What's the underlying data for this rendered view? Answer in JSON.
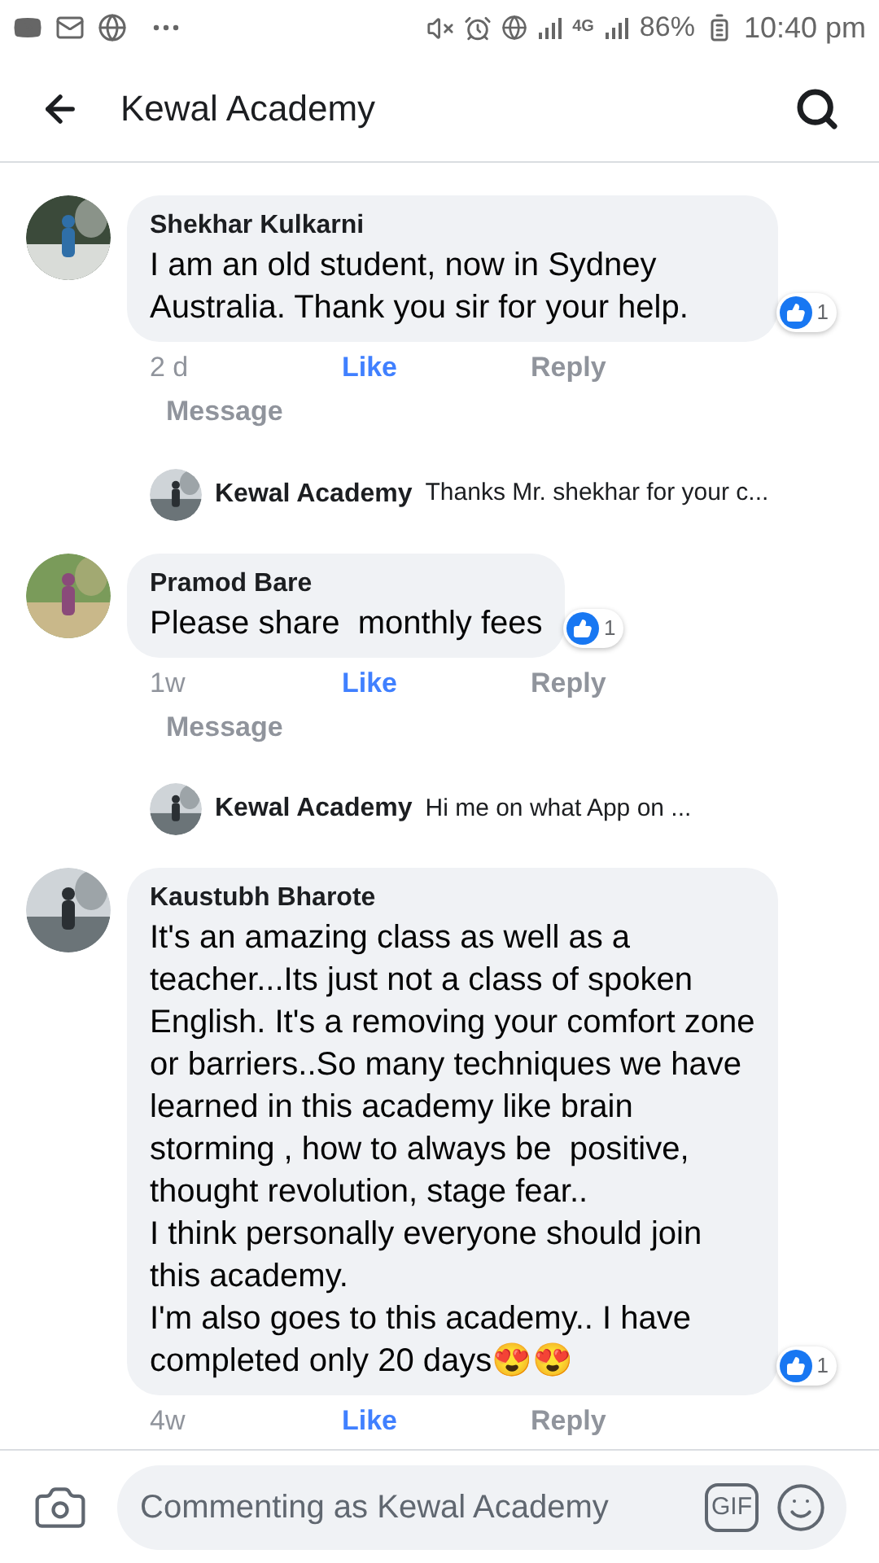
{
  "status_bar": {
    "network": "4G",
    "battery": "86%",
    "time": "10:40 pm"
  },
  "header": {
    "title": "Kewal Academy"
  },
  "comments": [
    {
      "author": "Shekhar Kulkarni",
      "text": "I am an old student, now in Sydney Australia. Thank you sir for your help.",
      "time": "2 d",
      "like": "Like",
      "reply": "Reply",
      "message": "Message",
      "reactions": "1",
      "liked": true,
      "reply_preview": {
        "author": "Kewal Academy",
        "text": "Thanks Mr. shekhar for your c..."
      }
    },
    {
      "author": "Pramod Bare",
      "text": "Please share  monthly fees",
      "time": "1w",
      "like": "Like",
      "reply": "Reply",
      "message": "Message",
      "reactions": "1",
      "liked": true,
      "reply_preview": {
        "author": "Kewal Academy",
        "text": "Hi me on what App on ..."
      }
    },
    {
      "author": "Kaustubh Bharote",
      "text": "It's an amazing class as well as a teacher...Its just not a class of spoken English. It's a removing your comfort zone or barriers..So many techniques we have learned in this academy like brain storming , how to always be  positive, thought revolution, stage fear..\nI think personally everyone should join this academy.\nI'm also goes to this academy.. I have completed only 20 days😍😍",
      "time": "4w",
      "like": "Like",
      "reply": "Reply",
      "reactions": "1",
      "liked": true
    }
  ],
  "composer": {
    "placeholder": "Commenting as Kewal Academy",
    "gif": "GIF"
  }
}
